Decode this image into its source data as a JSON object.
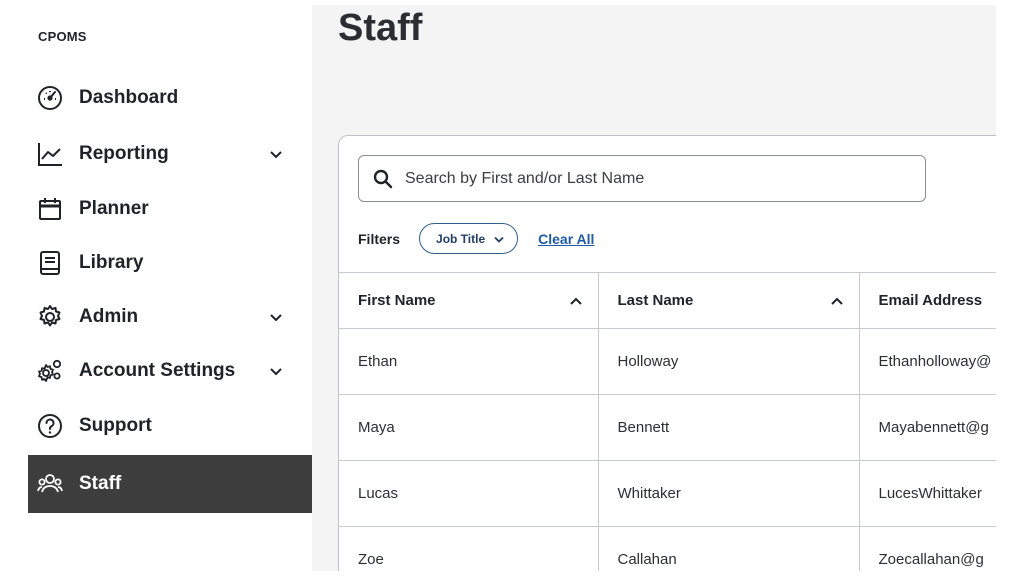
{
  "brand": "CPOMS",
  "sidebar": {
    "items": [
      {
        "label": "Dashboard",
        "icon": "dashboard-gauge-icon",
        "expandable": false
      },
      {
        "label": "Reporting",
        "icon": "line-chart-icon",
        "expandable": true
      },
      {
        "label": "Planner",
        "icon": "calendar-icon",
        "expandable": false
      },
      {
        "label": "Library",
        "icon": "book-icon",
        "expandable": false
      },
      {
        "label": "Admin",
        "icon": "gear-icon",
        "expandable": true
      },
      {
        "label": "Account Settings",
        "icon": "multi-gear-icon",
        "expandable": true
      },
      {
        "label": "Support",
        "icon": "question-circle-icon",
        "expandable": false
      },
      {
        "label": "Staff",
        "icon": "people-icon",
        "expandable": false,
        "active": true
      }
    ]
  },
  "page": {
    "title": "Staff"
  },
  "search": {
    "placeholder": "Search by First and/or Last Name"
  },
  "filters": {
    "label": "Filters",
    "chip": "Job Title",
    "clear": "Clear All"
  },
  "table": {
    "columns": [
      "First Name",
      "Last Name",
      "Email Address"
    ],
    "rows": [
      [
        "Ethan",
        "Holloway",
        "Ethanholloway@"
      ],
      [
        "Maya",
        "Bennett",
        "Mayabennett@g"
      ],
      [
        "Lucas",
        "Whittaker",
        "LucesWhittaker"
      ],
      [
        "Zoe",
        "Callahan",
        "Zoecallahan@g"
      ]
    ]
  },
  "colors": {
    "active_bg": "#3d3d3d",
    "link": "#1f5aa6",
    "main_bg": "#f4f4f5"
  }
}
